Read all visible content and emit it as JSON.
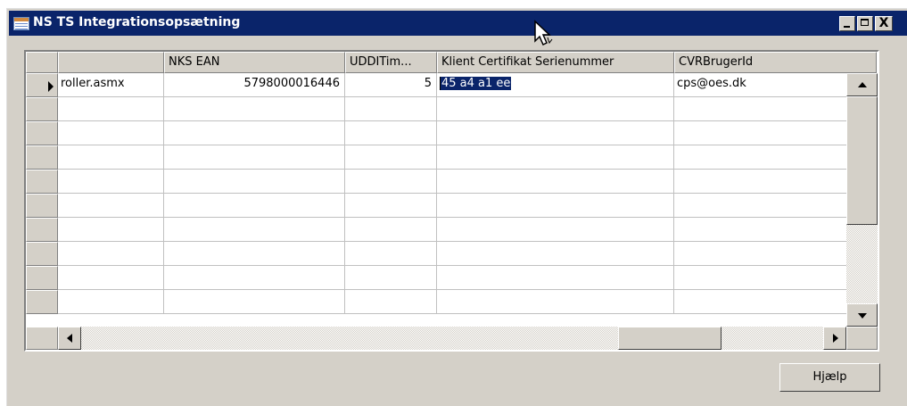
{
  "window": {
    "title": "NS TS Integrationsopsætning",
    "minimize_label": "_",
    "maximize_label": "□",
    "close_label": "X"
  },
  "grid": {
    "columns": [
      "",
      "NKS EAN",
      "UDDITim...",
      "Klient Certifikat Serienummer",
      "CVRBrugerId"
    ],
    "rows": [
      [
        "roller.asmx",
        "5798000016446",
        "5",
        "45 a4 a1 ee",
        "cps@oes.dk"
      ]
    ],
    "selected_cell_text": "45 a4 a1 ee",
    "empty_row_count": 9
  },
  "buttons": {
    "help_label": "Hjælp"
  },
  "colors": {
    "titlebar": "#0a246a",
    "window_bg": "#d4d0c8",
    "selection": "#0a246a"
  }
}
